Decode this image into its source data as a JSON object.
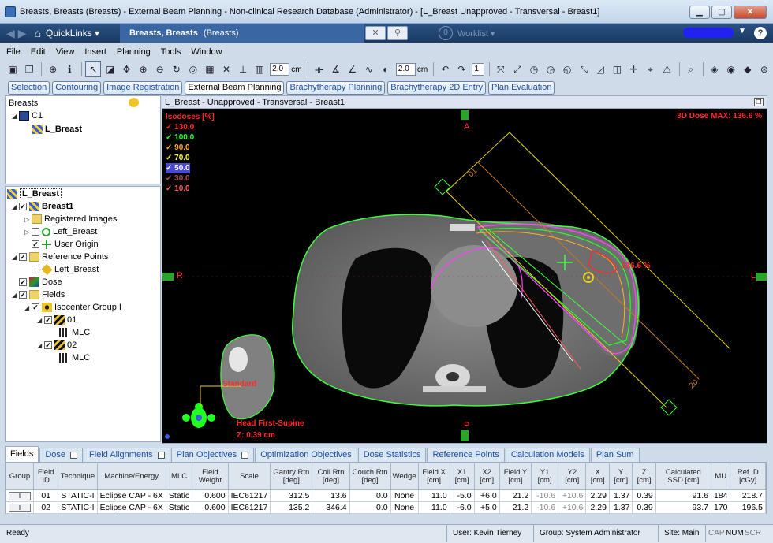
{
  "window": {
    "title": "Breasts, Breasts (Breasts) - External Beam Planning - Non-clinical Research Database (Administrator) - [L_Breast  Unapproved - Transversal - Breast1]",
    "controls": {
      "minimize": "▁",
      "maximize": "▢",
      "close": "✕"
    }
  },
  "nav": {
    "quicklinks": "QuickLinks ▾",
    "patient": "Breasts, Breasts",
    "patient_id": "(Breasts)",
    "clear": "✕",
    "search": "⚲",
    "worklist_badge": "0",
    "worklist": "Worklist ▾",
    "help": "?"
  },
  "menu": [
    "File",
    "Edit",
    "View",
    "Insert",
    "Planning",
    "Tools",
    "Window"
  ],
  "toolbar": {
    "thickness_value": "2.0",
    "thickness_unit": "cm",
    "step_value": "2.0",
    "step_unit": "cm",
    "count_value": "1"
  },
  "workspaces": [
    "Selection",
    "Contouring",
    "Image Registration",
    "External Beam Planning",
    "Brachytherapy Planning",
    "Brachytherapy 2D Entry",
    "Plan Evaluation"
  ],
  "active_workspace": "External Beam Planning",
  "tree1": {
    "patient": "Breasts",
    "course": "C1",
    "plan": "L_Breast"
  },
  "tree2": {
    "plan": "L_Breast",
    "image": "Breast1",
    "registered": "Registered Images",
    "structure": "Left_Breast",
    "user_origin": "User Origin",
    "ref_points": "Reference Points",
    "ref_point": "Left_Breast",
    "dose": "Dose",
    "fields": "Fields",
    "iso_group": "Isocenter Group I",
    "field1": "01",
    "mlc1": "MLC",
    "field2": "02",
    "mlc2": "MLC"
  },
  "viewer": {
    "header": "L_Breast  -  Unapproved - Transversal - Breast1",
    "isodose_title": "Isodoses [%]",
    "isodoses": [
      {
        "label": "✓ 130.0",
        "color": "#ff2a2a"
      },
      {
        "label": "✓ 100.0",
        "color": "#22ff22"
      },
      {
        "label": "✓ 90.0",
        "color": "#ffb020"
      },
      {
        "label": "✓ 70.0",
        "color": "#ffff30"
      },
      {
        "label": "✓ 50.0",
        "color": "#ffffff"
      },
      {
        "label": "✓ 30.0",
        "color": "#b05050"
      },
      {
        "label": "✓ 10.0",
        "color": "#ff5a5a"
      }
    ],
    "dose_max": "3D Dose MAX: 136.6 %",
    "hotspot": "136.6 %",
    "orient_top": "A",
    "orient_bottom": "P",
    "orient_left": "R",
    "orient_right": "L",
    "beam1_label": "01",
    "beam2_label": "20",
    "protocol": "Standard",
    "position": "Head First-Supine",
    "zpos": "Z: 0.39 cm"
  },
  "tabs": [
    {
      "label": "Fields",
      "checkbox": false
    },
    {
      "label": "Dose",
      "checkbox": true
    },
    {
      "label": "Field Alignments",
      "checkbox": true
    },
    {
      "label": "Plan Objectives",
      "checkbox": true
    },
    {
      "label": "Optimization Objectives",
      "checkbox": false
    },
    {
      "label": "Dose Statistics",
      "checkbox": false
    },
    {
      "label": "Reference Points",
      "checkbox": false
    },
    {
      "label": "Calculation Models",
      "checkbox": false
    },
    {
      "label": "Plan Sum",
      "checkbox": false
    }
  ],
  "table": {
    "headers": [
      "Group",
      "Field ID",
      "Technique",
      "Machine/Energy",
      "MLC",
      "Field Weight",
      "Scale",
      "Gantry Rtn [deg]",
      "Coll Rtn [deg]",
      "Couch Rtn [deg]",
      "Wedge",
      "Field X [cm]",
      "X1 [cm]",
      "X2 [cm]",
      "Field Y [cm]",
      "Y1 [cm]",
      "Y2 [cm]",
      "X [cm]",
      "Y [cm]",
      "Z [cm]",
      "Calculated SSD [cm]",
      "MU",
      "Ref. D [cGy]"
    ],
    "rows": [
      [
        "I",
        "01",
        "STATIC-I",
        "Eclipse CAP - 6X",
        "Static",
        "0.600",
        "IEC61217",
        "312.5",
        "13.6",
        "0.0",
        "None",
        "11.0",
        "-5.0",
        "+6.0",
        "21.2",
        "-10.6",
        "+10.6",
        "2.29",
        "1.37",
        "0.39",
        "91.6",
        "184",
        "218.7"
      ],
      [
        "I",
        "02",
        "STATIC-I",
        "Eclipse CAP - 6X",
        "Static",
        "0.600",
        "IEC61217",
        "135.2",
        "346.4",
        "0.0",
        "None",
        "11.0",
        "-6.0",
        "+5.0",
        "21.2",
        "-10.6",
        "+10.6",
        "2.29",
        "1.37",
        "0.39",
        "93.7",
        "170",
        "196.5"
      ]
    ]
  },
  "status": {
    "ready": "Ready",
    "user": "User: Kevin Tierney",
    "group": "Group: System Administrator",
    "site": "Site: Main",
    "caps": "CAP",
    "num": "NUM",
    "scrl": "SCR"
  },
  "colors": {
    "body_contour": "#3cff3c",
    "breast_contour": "#ff40ff",
    "beam_field": "#e6d21e",
    "dose_max": "#ff2a2a"
  }
}
